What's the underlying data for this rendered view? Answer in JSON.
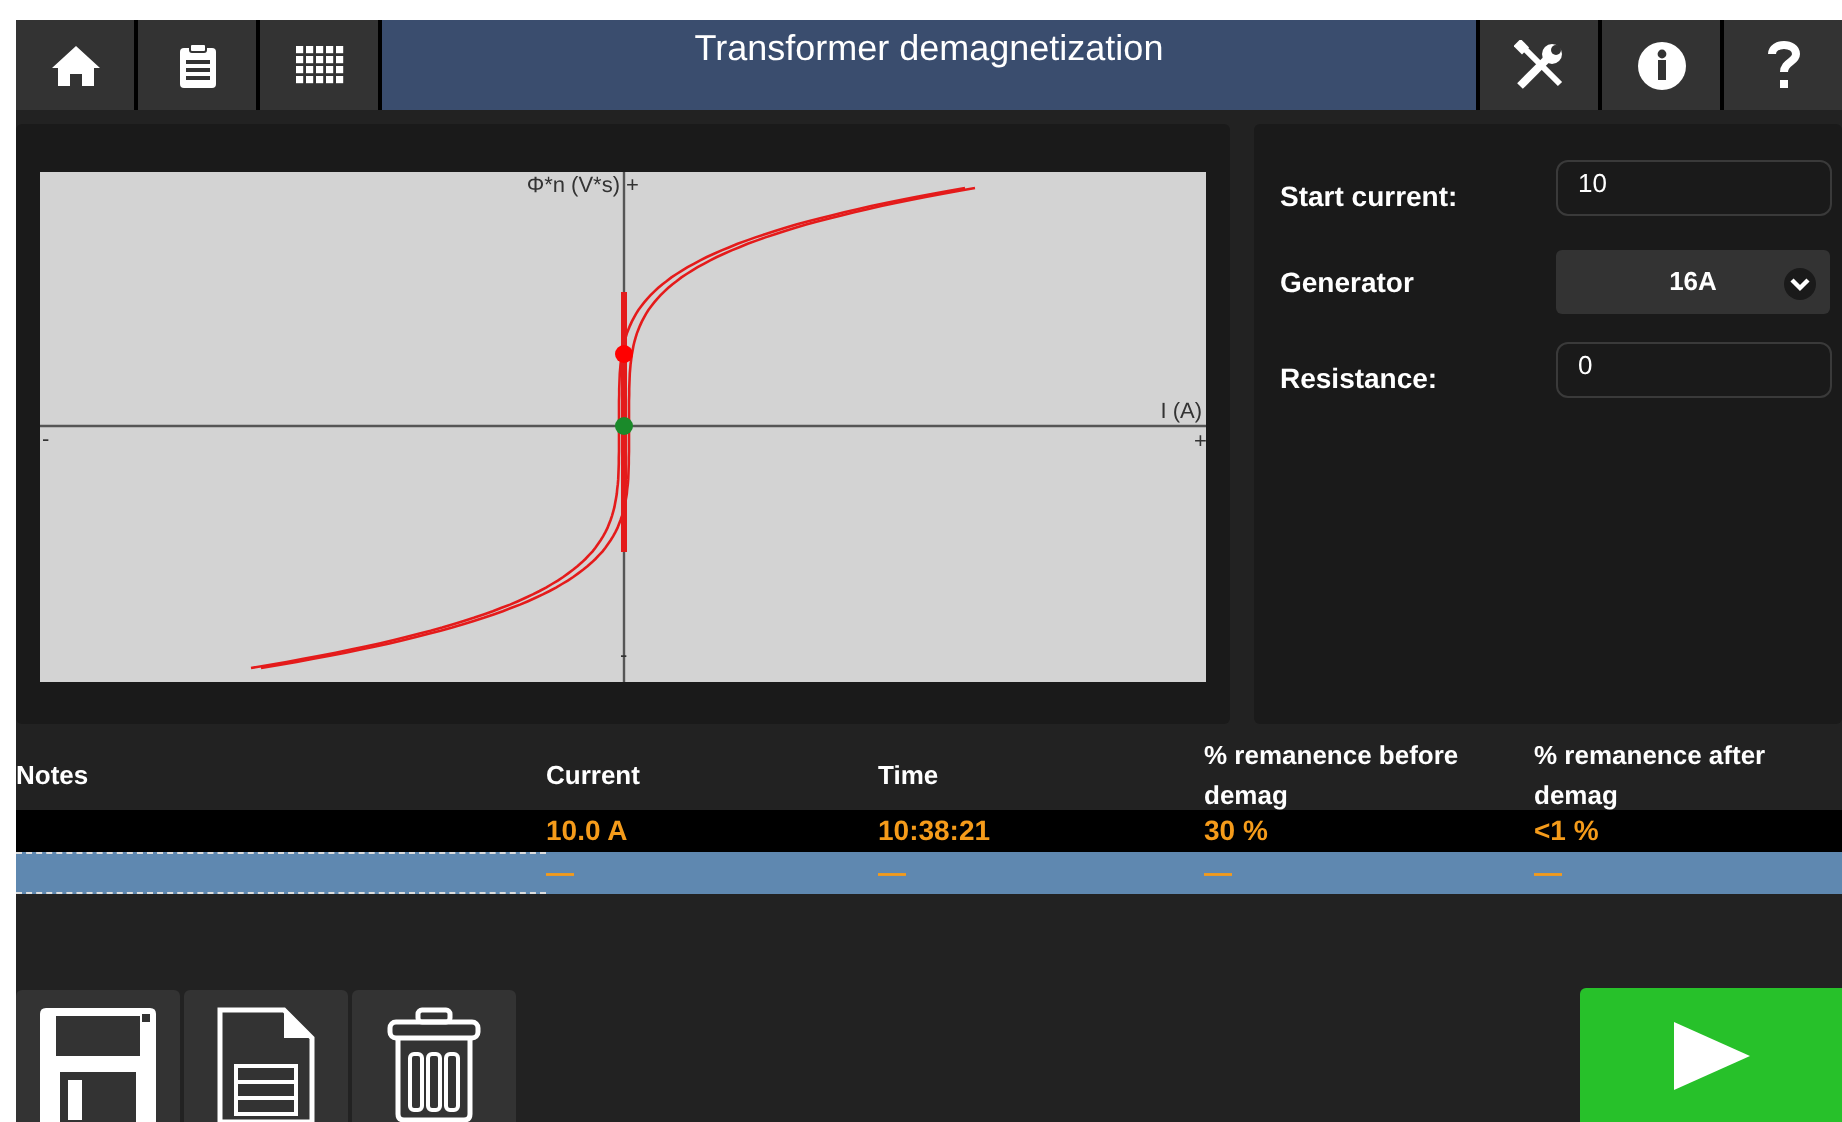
{
  "title": "Transformer demagnetization",
  "chart": {
    "y_label": "Φ*n (V*s)",
    "y_plus": "+",
    "y_minus": "-",
    "x_label": "I (A)",
    "x_plus": "+",
    "x_minus": "-"
  },
  "settings": [
    {
      "kind": "input",
      "label": "Start current:",
      "value": "10"
    },
    {
      "kind": "select",
      "label": "Generator",
      "value": "16A"
    },
    {
      "kind": "input",
      "label": "Resistance:",
      "value": "0"
    }
  ],
  "table": {
    "columns": [
      "Notes",
      "Current",
      "Time",
      "% remanence before demag",
      "% remanence after demag"
    ],
    "rows": [
      {
        "selected": false,
        "current": "10.0 A",
        "time": "10:38:21",
        "before": "30 %",
        "after": "<1 %"
      },
      {
        "selected": true,
        "current": "—",
        "time": "—",
        "before": "—",
        "after": "—"
      }
    ]
  }
}
